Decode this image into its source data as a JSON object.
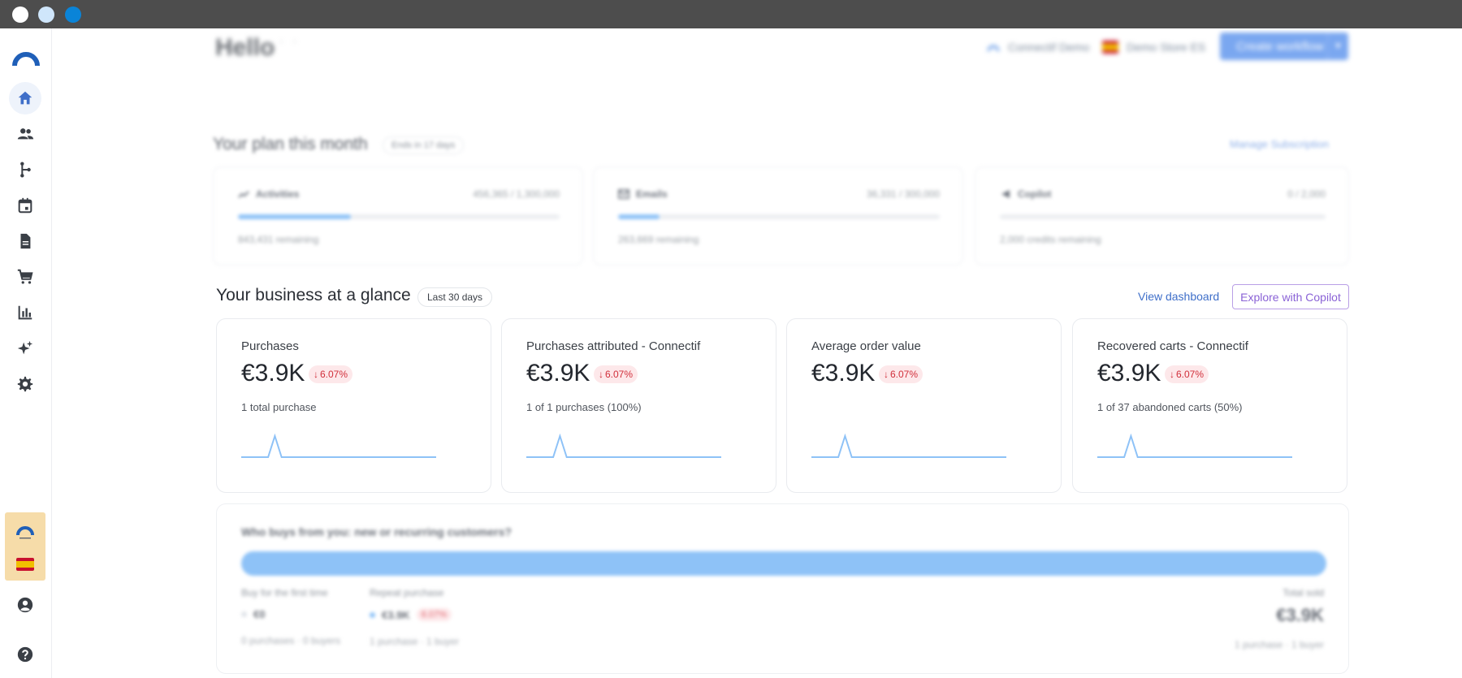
{
  "header": {
    "greeting": "Hello",
    "greeting_suffix": "· ·",
    "workspace": "Connectif Demo",
    "store": "Demo Store ES",
    "create_button": "Create workflow"
  },
  "plan": {
    "title": "Your plan this month",
    "badge": "Ends in 17 days",
    "manage_link": "Manage Subscription",
    "cards": [
      {
        "label": "Activities",
        "value": "456,365 / 1,300,000",
        "remaining": "843,431 remaining",
        "fill_fraction": 0.35
      },
      {
        "label": "Emails",
        "value": "36,331 / 300,000",
        "remaining": "263,669 remaining",
        "fill_fraction": 0.13
      },
      {
        "label": "Copilot",
        "value": "0 / 2,000",
        "remaining": "2,000 credits remaining",
        "fill_fraction": 0.0
      }
    ]
  },
  "glance": {
    "title": "Your business at a glance",
    "badge": "Last 30 days",
    "view_dashboard": "View dashboard",
    "explore_copilot": "Explore with Copilot",
    "kpis": [
      {
        "label": "Purchases",
        "value": "€3.9K",
        "delta": "6.07%",
        "sub": "1 total purchase"
      },
      {
        "label": "Purchases attributed - Connectif",
        "value": "€3.9K",
        "delta": "6.07%",
        "sub": "1 of 1 purchases (100%)"
      },
      {
        "label": "Average order value",
        "value": "€3.9K",
        "delta": "6.07%",
        "sub": ""
      },
      {
        "label": "Recovered carts - Connectif",
        "value": "€3.9K",
        "delta": "6.07%",
        "sub": "1 of 37 abandoned carts (50%)"
      }
    ],
    "sparkline": [
      0,
      0,
      0,
      0,
      0,
      1,
      0,
      0,
      0,
      0,
      0,
      0,
      0,
      0,
      0,
      0,
      0,
      0,
      0,
      0,
      0,
      0,
      0,
      0,
      0,
      0,
      0,
      0,
      0,
      0
    ]
  },
  "who": {
    "title": "Who buys from you: new or recurring customers?",
    "first": {
      "label": "Buy for the first time",
      "value": "€0",
      "sub": "0 purchases · 0 buyers"
    },
    "repeat": {
      "label": "Repeat purchase",
      "value": "€3.9K",
      "delta": "6.07%",
      "sub": "1 purchase · 1 buyer"
    },
    "total": {
      "label": "Total sold",
      "value": "€3.9K",
      "sub": "1 purchase · 1 buyer"
    }
  },
  "colors": {
    "accent": "#3f6fc9",
    "bar": "#8ec2f7",
    "delta_bg": "#fde8ea",
    "delta_fg": "#d12e3a",
    "account_bg": "#f6dca9"
  },
  "icons": {
    "nav": [
      "home-icon",
      "users-icon",
      "workflow-icon",
      "calendar-icon",
      "document-icon",
      "cart-icon",
      "chart-icon",
      "sparkles-icon",
      "gear-icon"
    ],
    "bottom": [
      "account-circle-icon",
      "help-icon"
    ]
  }
}
